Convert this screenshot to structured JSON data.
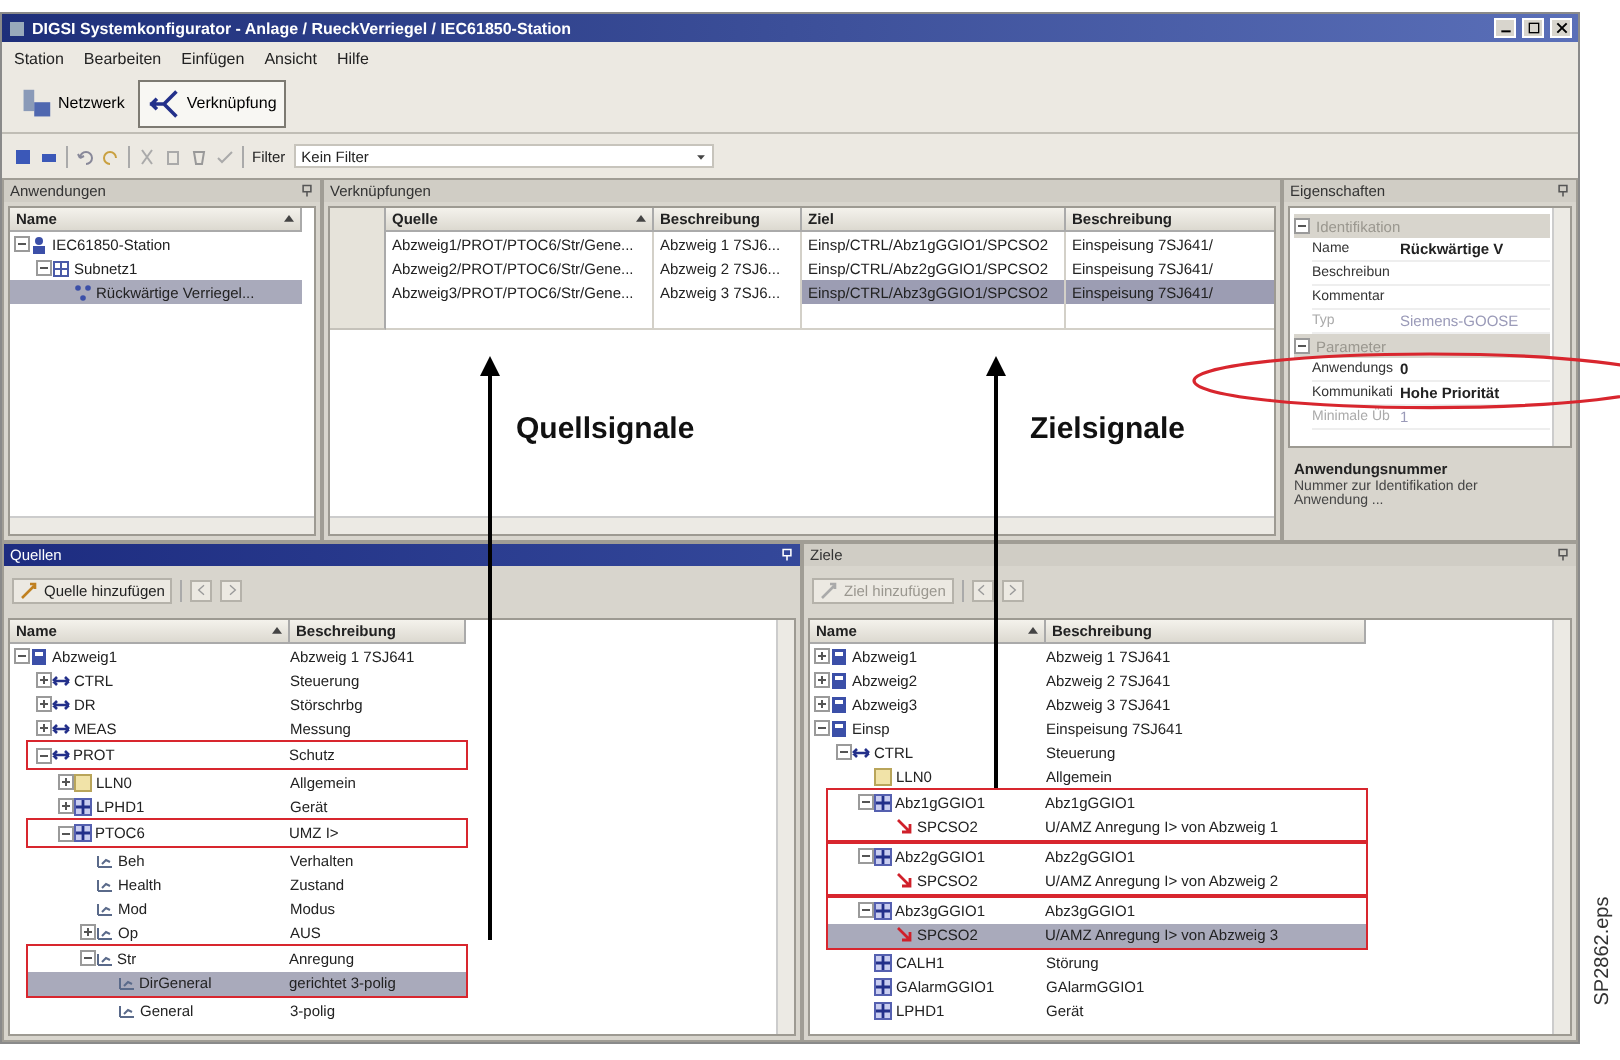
{
  "window": {
    "title": "DIGSI Systemkonfigurator - Anlage / RueckVerriegel / IEC61850-Station"
  },
  "menu": [
    "Station",
    "Bearbeiten",
    "Einfügen",
    "Ansicht",
    "Hilfe"
  ],
  "view_buttons": [
    {
      "label": "Netzwerk",
      "kind": "network",
      "selected": false
    },
    {
      "label": "Verknüpfung",
      "kind": "link",
      "selected": true
    }
  ],
  "filter": {
    "label": "Filter",
    "value": "Kein Filter"
  },
  "anwendungen": {
    "title": "Anwendungen",
    "column": "Name",
    "tree": [
      {
        "name": "IEC61850-Station",
        "kind": "station",
        "expanded": true,
        "selected": false,
        "children": [
          {
            "name": "Subnetz1",
            "kind": "subnet",
            "expanded": true,
            "selected": false,
            "children": [
              {
                "name": "Rückwärtige Verriegel...",
                "kind": "app",
                "selected": true
              }
            ]
          }
        ]
      }
    ]
  },
  "verknuepfungen": {
    "title": "Verknüpfungen",
    "columns": [
      "Quelle",
      "Beschreibung",
      "Ziel",
      "Beschreibung"
    ],
    "rows": [
      {
        "cells": [
          {
            "text": "Abzweig1/PROT/PTOC6/Str/Gene...",
            "selected": false
          },
          {
            "text": "Abzweig 1 7SJ6...",
            "selected": false
          },
          {
            "text": "Einsp/CTRL/Abz1gGGIO1/SPCSO2",
            "selected": false
          },
          {
            "text": "Einspeisung 7SJ641/",
            "selected": false
          }
        ]
      },
      {
        "cells": [
          {
            "text": "Abzweig2/PROT/PTOC6/Str/Gene...",
            "selected": false
          },
          {
            "text": "Abzweig 2 7SJ6...",
            "selected": false
          },
          {
            "text": "Einsp/CTRL/Abz2gGGIO1/SPCSO2",
            "selected": false
          },
          {
            "text": "Einspeisung 7SJ641/",
            "selected": false
          }
        ]
      },
      {
        "cells": [
          {
            "text": "Abzweig3/PROT/PTOC6/Str/Gene...",
            "selected": false
          },
          {
            "text": "Abzweig 3 7SJ6...",
            "selected": false
          },
          {
            "text": "Einsp/CTRL/Abz3gGGIO1/SPCSO2",
            "selected": true
          },
          {
            "text": "Einspeisung 7SJ641/",
            "selected": true
          }
        ]
      }
    ]
  },
  "eigenschaften": {
    "title": "Eigenschaften",
    "categories": [
      {
        "name": "Identifikation",
        "expanded": true,
        "rows": [
          {
            "label": "Name",
            "value": "Rückwärtige V",
            "disabled": false
          },
          {
            "label": "Beschreibun",
            "disabled": false
          },
          {
            "label": "Kommentar",
            "disabled": false
          },
          {
            "label": "Typ",
            "value": "Siemens-GOOSE",
            "disabled": true
          }
        ]
      },
      {
        "name": "Parameter",
        "expanded": true,
        "rows": [
          {
            "label": "Anwendungs",
            "value": "0",
            "disabled": false
          },
          {
            "label": "Kommunikati",
            "value": "Hohe Priorität",
            "disabled": false
          },
          {
            "label": "Minimale Üb",
            "value": "1",
            "disabled": true
          }
        ]
      }
    ],
    "help_title": "Anwendungsnummer",
    "help_text": "Nummer zur Identifikation der Anwendung ..."
  },
  "quellen": {
    "title": "Quellen",
    "active": true,
    "add_button": {
      "label": "Quelle hinzufügen",
      "disabled": false
    },
    "columns": [
      "Name",
      "Beschreibung"
    ],
    "tree": [
      {
        "name": "Abzweig1",
        "description": "Abzweig 1 7SJ641",
        "kind": "device",
        "expanded": true,
        "selected": false,
        "marked": false,
        "children": [
          {
            "name": "CTRL",
            "description": "Steuerung",
            "kind": "ln",
            "expanded": false,
            "selected": false,
            "marked": false
          },
          {
            "name": "DR",
            "description": "Störschrbg",
            "kind": "ln",
            "expanded": false,
            "selected": false,
            "marked": false
          },
          {
            "name": "MEAS",
            "description": "Messung",
            "kind": "ln",
            "expanded": false,
            "selected": false,
            "marked": false
          },
          {
            "name": "PROT",
            "description": "Schutz",
            "kind": "ln",
            "expanded": true,
            "selected": false,
            "marked": true,
            "children": [
              {
                "name": "LLN0",
                "description": "Allgemein",
                "kind": "folder",
                "expanded": false,
                "selected": false,
                "marked": false
              },
              {
                "name": "LPHD1",
                "description": "Gerät",
                "kind": "lnode",
                "expanded": false,
                "selected": false,
                "marked": false
              },
              {
                "name": "PTOC6",
                "description": "UMZ I>",
                "kind": "lnode",
                "expanded": true,
                "selected": false,
                "marked": true,
                "children": [
                  {
                    "name": "Beh",
                    "description": "Verhalten",
                    "kind": "data",
                    "selected": false,
                    "marked": false
                  },
                  {
                    "name": "Health",
                    "description": "Zustand",
                    "kind": "data",
                    "selected": false,
                    "marked": false
                  },
                  {
                    "name": "Mod",
                    "description": "Modus",
                    "kind": "data",
                    "selected": false,
                    "marked": false
                  },
                  {
                    "name": "Op",
                    "description": "AUS",
                    "kind": "data",
                    "expanded": false,
                    "selected": false,
                    "marked": false
                  },
                  {
                    "name": "Str",
                    "description": "Anregung",
                    "kind": "data",
                    "expanded": true,
                    "selected": false,
                    "marked": true,
                    "children": [
                      {
                        "name": "DirGeneral",
                        "description": "gerichtet 3-polig",
                        "kind": "data",
                        "selected": true,
                        "marked": true
                      },
                      {
                        "name": "General",
                        "description": "3-polig",
                        "kind": "data",
                        "selected": false,
                        "marked": false
                      }
                    ]
                  }
                ]
              }
            ]
          }
        ]
      }
    ]
  },
  "ziele": {
    "title": "Ziele",
    "active": false,
    "add_button": {
      "label": "Ziel hinzufügen",
      "disabled": true
    },
    "columns": [
      "Name",
      "Beschreibung"
    ],
    "tree": [
      {
        "name": "Abzweig1",
        "description": "Abzweig 1 7SJ641",
        "kind": "device",
        "expanded": false,
        "selected": false,
        "marked": false
      },
      {
        "name": "Abzweig2",
        "description": "Abzweig 2 7SJ641",
        "kind": "device",
        "expanded": false,
        "selected": false,
        "marked": false
      },
      {
        "name": "Abzweig3",
        "description": "Abzweig 3 7SJ641",
        "kind": "device",
        "expanded": false,
        "selected": false,
        "marked": false
      },
      {
        "name": "Einsp",
        "description": "Einspeisung 7SJ641",
        "kind": "device",
        "expanded": true,
        "selected": false,
        "marked": false,
        "children": [
          {
            "name": "CTRL",
            "description": "Steuerung",
            "kind": "ln",
            "expanded": true,
            "selected": false,
            "marked": false,
            "children": [
              {
                "name": "LLN0",
                "description": "Allgemein",
                "kind": "folder",
                "selected": false,
                "marked": false
              },
              {
                "name": "Abz1gGGIO1",
                "description": "Abz1gGGIO1",
                "kind": "lnode",
                "expanded": true,
                "selected": false,
                "marked": true,
                "children": [
                  {
                    "name": "SPCSO2",
                    "description": "U/AMZ Anregung I> von Abzweig 1",
                    "kind": "link",
                    "selected": false,
                    "marked": true
                  }
                ]
              },
              {
                "name": "Abz2gGGIO1",
                "description": "Abz2gGGIO1",
                "kind": "lnode",
                "expanded": true,
                "selected": false,
                "marked": true,
                "children": [
                  {
                    "name": "SPCSO2",
                    "description": "U/AMZ Anregung I> von Abzweig 2",
                    "kind": "link",
                    "selected": false,
                    "marked": true
                  }
                ]
              },
              {
                "name": "Abz3gGGIO1",
                "description": "Abz3gGGIO1",
                "kind": "lnode",
                "expanded": true,
                "selected": false,
                "marked": true,
                "children": [
                  {
                    "name": "SPCSO2",
                    "description": "U/AMZ Anregung I> von Abzweig 3",
                    "kind": "link",
                    "selected": true,
                    "marked": true
                  }
                ]
              },
              {
                "name": "CALH1",
                "description": "Störung",
                "kind": "lnode",
                "selected": false,
                "marked": false
              },
              {
                "name": "GAlarmGGIO1",
                "description": "GAlarmGGIO1",
                "kind": "lnode",
                "selected": false,
                "marked": false
              },
              {
                "name": "LPHD1",
                "description": "Gerät",
                "kind": "lnode",
                "selected": false,
                "marked": false
              }
            ]
          }
        ]
      }
    ]
  },
  "annotations": [
    {
      "kind": "source",
      "text": "Quellsignale"
    },
    {
      "kind": "target",
      "text": "Zielsignale"
    }
  ],
  "figure_label": "SP2862.eps"
}
